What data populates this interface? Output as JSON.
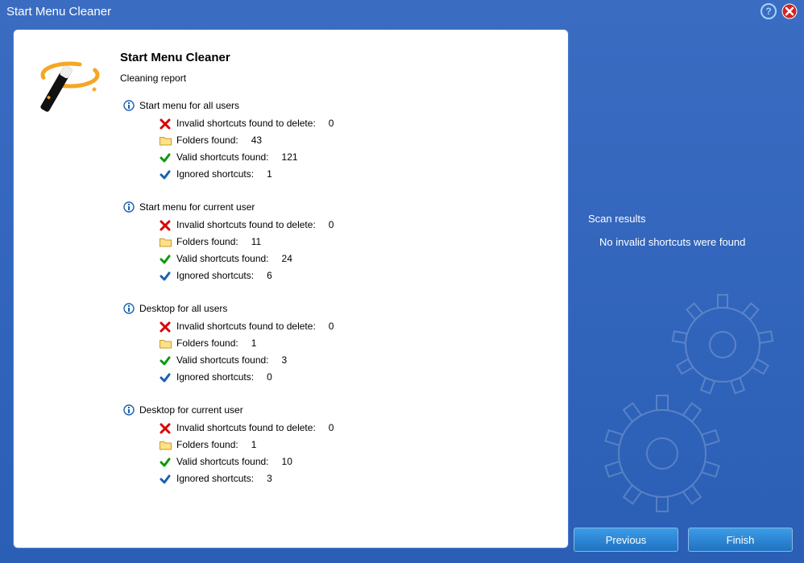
{
  "titlebar": {
    "title": "Start Menu Cleaner"
  },
  "main": {
    "title": "Start Menu Cleaner",
    "subtitle": "Cleaning report",
    "sections": [
      {
        "title": "Start menu for all users",
        "items": [
          {
            "label": "Invalid shortcuts found to delete:",
            "value": "0"
          },
          {
            "label": "Folders found:",
            "value": "43"
          },
          {
            "label": "Valid shortcuts found:",
            "value": "121"
          },
          {
            "label": "Ignored shortcuts:",
            "value": "1"
          }
        ]
      },
      {
        "title": "Start menu for current user",
        "items": [
          {
            "label": "Invalid shortcuts found to delete:",
            "value": "0"
          },
          {
            "label": "Folders found:",
            "value": "11"
          },
          {
            "label": "Valid shortcuts found:",
            "value": "24"
          },
          {
            "label": "Ignored shortcuts:",
            "value": "6"
          }
        ]
      },
      {
        "title": "Desktop for all users",
        "items": [
          {
            "label": "Invalid shortcuts found to delete:",
            "value": "0"
          },
          {
            "label": "Folders found:",
            "value": "1"
          },
          {
            "label": "Valid shortcuts found:",
            "value": "3"
          },
          {
            "label": "Ignored shortcuts:",
            "value": "0"
          }
        ]
      },
      {
        "title": "Desktop for current user",
        "items": [
          {
            "label": "Invalid shortcuts found to delete:",
            "value": "0"
          },
          {
            "label": "Folders found:",
            "value": "1"
          },
          {
            "label": "Valid shortcuts found:",
            "value": "10"
          },
          {
            "label": "Ignored shortcuts:",
            "value": "3"
          }
        ]
      }
    ]
  },
  "results": {
    "title": "Scan results",
    "text": "No invalid shortcuts were found"
  },
  "buttons": {
    "previous": "Previous",
    "finish": "Finish"
  }
}
